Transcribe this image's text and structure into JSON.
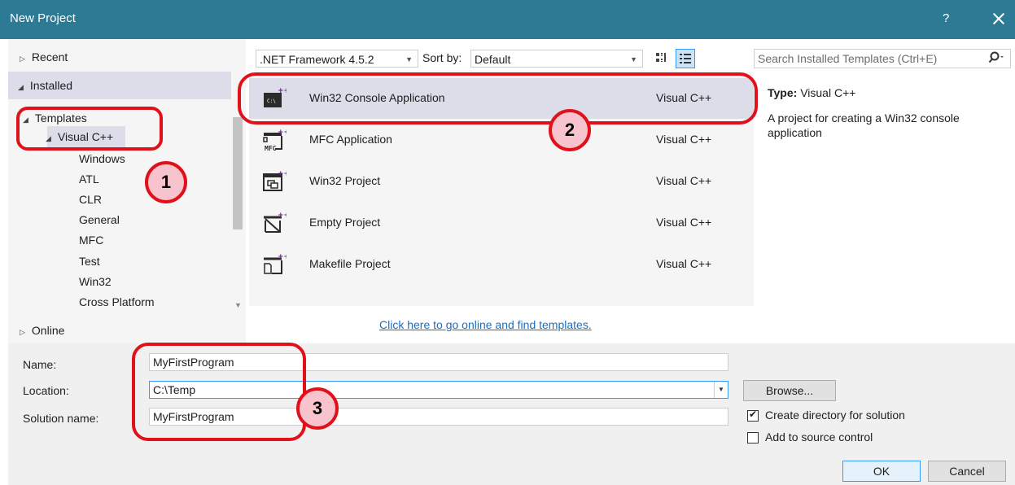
{
  "window": {
    "title": "New Project",
    "help_glyph": "?"
  },
  "left_nav": {
    "recent": "Recent",
    "installed": "Installed",
    "templates": "Templates",
    "visual_cpp": "Visual C++",
    "children": [
      "Windows",
      "ATL",
      "CLR",
      "General",
      "MFC",
      "Test",
      "Win32",
      "Cross Platform"
    ],
    "online": "Online"
  },
  "toolbar": {
    "framework": ".NET Framework 4.5.2",
    "sort_by_label": "Sort by:",
    "sort_value": "Default",
    "search_placeholder": "Search Installed Templates (Ctrl+E)"
  },
  "templates": [
    {
      "name": "Win32 Console Application",
      "lang": "Visual C++",
      "icon": "console-app-icon"
    },
    {
      "name": "MFC Application",
      "lang": "Visual C++",
      "icon": "mfc-app-icon"
    },
    {
      "name": "Win32 Project",
      "lang": "Visual C++",
      "icon": "win32-project-icon"
    },
    {
      "name": "Empty Project",
      "lang": "Visual C++",
      "icon": "empty-project-icon"
    },
    {
      "name": "Makefile Project",
      "lang": "Visual C++",
      "icon": "makefile-project-icon"
    }
  ],
  "online_link": "Click here to go online and find templates.",
  "details": {
    "type_label": "Type:",
    "type_value": "Visual C++",
    "description": "A project for creating a Win32 console application"
  },
  "form": {
    "name_label": "Name:",
    "name_value": "MyFirstProgram",
    "location_label": "Location:",
    "location_value": "C:\\Temp",
    "solution_label": "Solution name:",
    "solution_value": "MyFirstProgram",
    "browse": "Browse...",
    "create_dir": "Create directory for solution",
    "create_dir_checked": true,
    "source_control": "Add to source control",
    "source_control_checked": false,
    "ok": "OK",
    "cancel": "Cancel"
  },
  "annotations": [
    "1",
    "2",
    "3"
  ],
  "colors": {
    "titlebar": "#2d7a94",
    "selection": "#dcdde8",
    "annotation": "#e0111b",
    "link": "#1a6fc4"
  }
}
